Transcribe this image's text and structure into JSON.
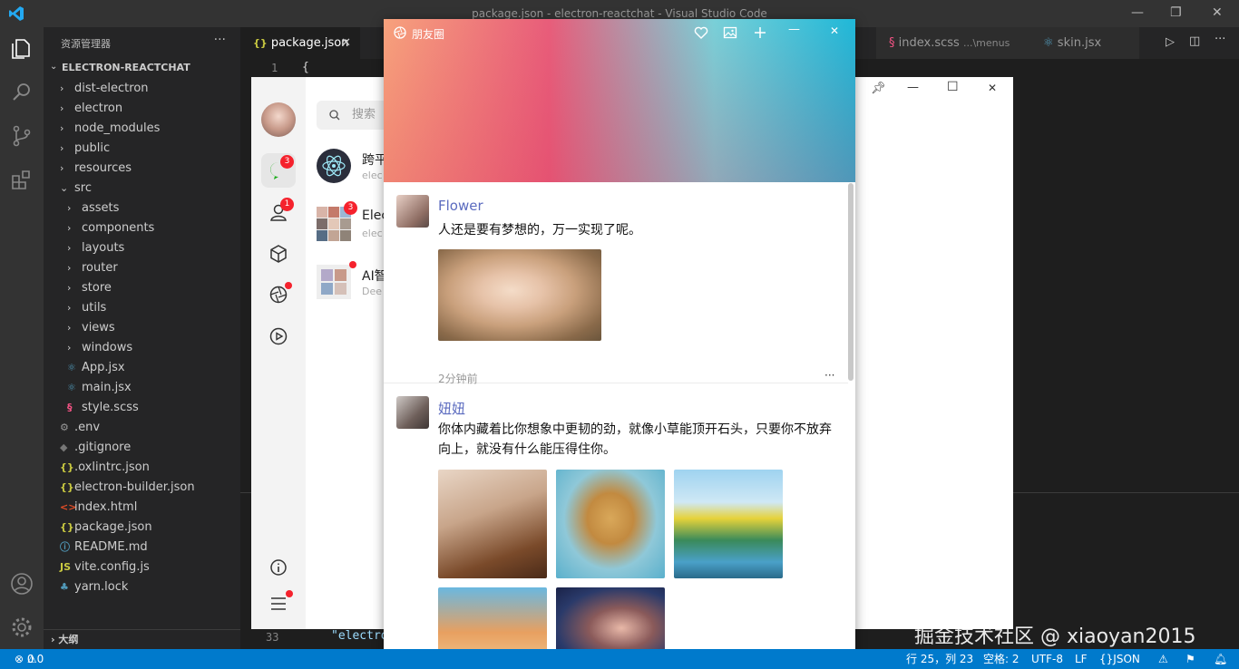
{
  "vscode": {
    "window_title": "package.json - electron-reactchat - Visual Studio Code",
    "explorer_title": "资源管理器",
    "project": "ELECTRON-REACTCHAT",
    "outline": "大纲",
    "tree": [
      {
        "label": "dist-electron",
        "type": "folder",
        "depth": 0
      },
      {
        "label": "electron",
        "type": "folder",
        "depth": 0
      },
      {
        "label": "node_modules",
        "type": "folder",
        "depth": 0
      },
      {
        "label": "public",
        "type": "folder",
        "depth": 0
      },
      {
        "label": "resources",
        "type": "folder",
        "depth": 0
      },
      {
        "label": "src",
        "type": "folder-open",
        "depth": 0
      },
      {
        "label": "assets",
        "type": "folder",
        "depth": 1
      },
      {
        "label": "components",
        "type": "folder",
        "depth": 1
      },
      {
        "label": "layouts",
        "type": "folder",
        "depth": 1
      },
      {
        "label": "router",
        "type": "folder",
        "depth": 1
      },
      {
        "label": "store",
        "type": "folder",
        "depth": 1
      },
      {
        "label": "utils",
        "type": "folder",
        "depth": 1
      },
      {
        "label": "views",
        "type": "folder",
        "depth": 1
      },
      {
        "label": "windows",
        "type": "folder",
        "depth": 1
      },
      {
        "label": "App.jsx",
        "type": "react",
        "depth": 1
      },
      {
        "label": "main.jsx",
        "type": "react",
        "depth": 1
      },
      {
        "label": "style.scss",
        "type": "scss",
        "depth": 1
      },
      {
        "label": ".env",
        "type": "gear",
        "depth": 0
      },
      {
        "label": ".gitignore",
        "type": "git",
        "depth": 0
      },
      {
        "label": ".oxlintrc.json",
        "type": "json",
        "depth": 0
      },
      {
        "label": "electron-builder.json",
        "type": "json",
        "depth": 0
      },
      {
        "label": "index.html",
        "type": "html",
        "depth": 0
      },
      {
        "label": "package.json",
        "type": "json",
        "depth": 0
      },
      {
        "label": "README.md",
        "type": "info",
        "depth": 0
      },
      {
        "label": "vite.config.js",
        "type": "js",
        "depth": 0
      },
      {
        "label": "yarn.lock",
        "type": "yarn",
        "depth": 0
      }
    ],
    "tabs": {
      "active": "package.json",
      "scss": "index.scss",
      "scss_path": "...\\menus",
      "skin": "skin.jsx"
    },
    "editor": {
      "line1": "1",
      "line1_code": "{",
      "line33": "33",
      "line33_code": "\"electro"
    },
    "status": {
      "errors": "0",
      "warnings": "0",
      "position": "行 25，列 23",
      "spaces": "空格: 2",
      "encoding": "UTF-8",
      "eol": "LF",
      "language": "JSON"
    }
  },
  "chat": {
    "search_placeholder": "搜索",
    "nav_badges": {
      "chat": "3",
      "contacts": "1"
    },
    "conversations": [
      {
        "name": "跨平",
        "sub": "elec"
      },
      {
        "name": "Elec",
        "sub": "elec",
        "badge": "3"
      },
      {
        "name": "AI智",
        "sub": "Dee"
      }
    ]
  },
  "moments": {
    "title": "朋友圈",
    "posts": [
      {
        "name": "Flower",
        "text": "人还是要有梦想的，万一实现了呢。",
        "time": "2分钟前",
        "more": "···"
      },
      {
        "name": "妞妞",
        "text": "你体内藏着比你想象中更韧的劲，就像小草能顶开石头，只要你不放弃向上，就没有什么能压得住你。"
      }
    ]
  },
  "watermark": "掘金技术社区 @ xiaoyan2015"
}
